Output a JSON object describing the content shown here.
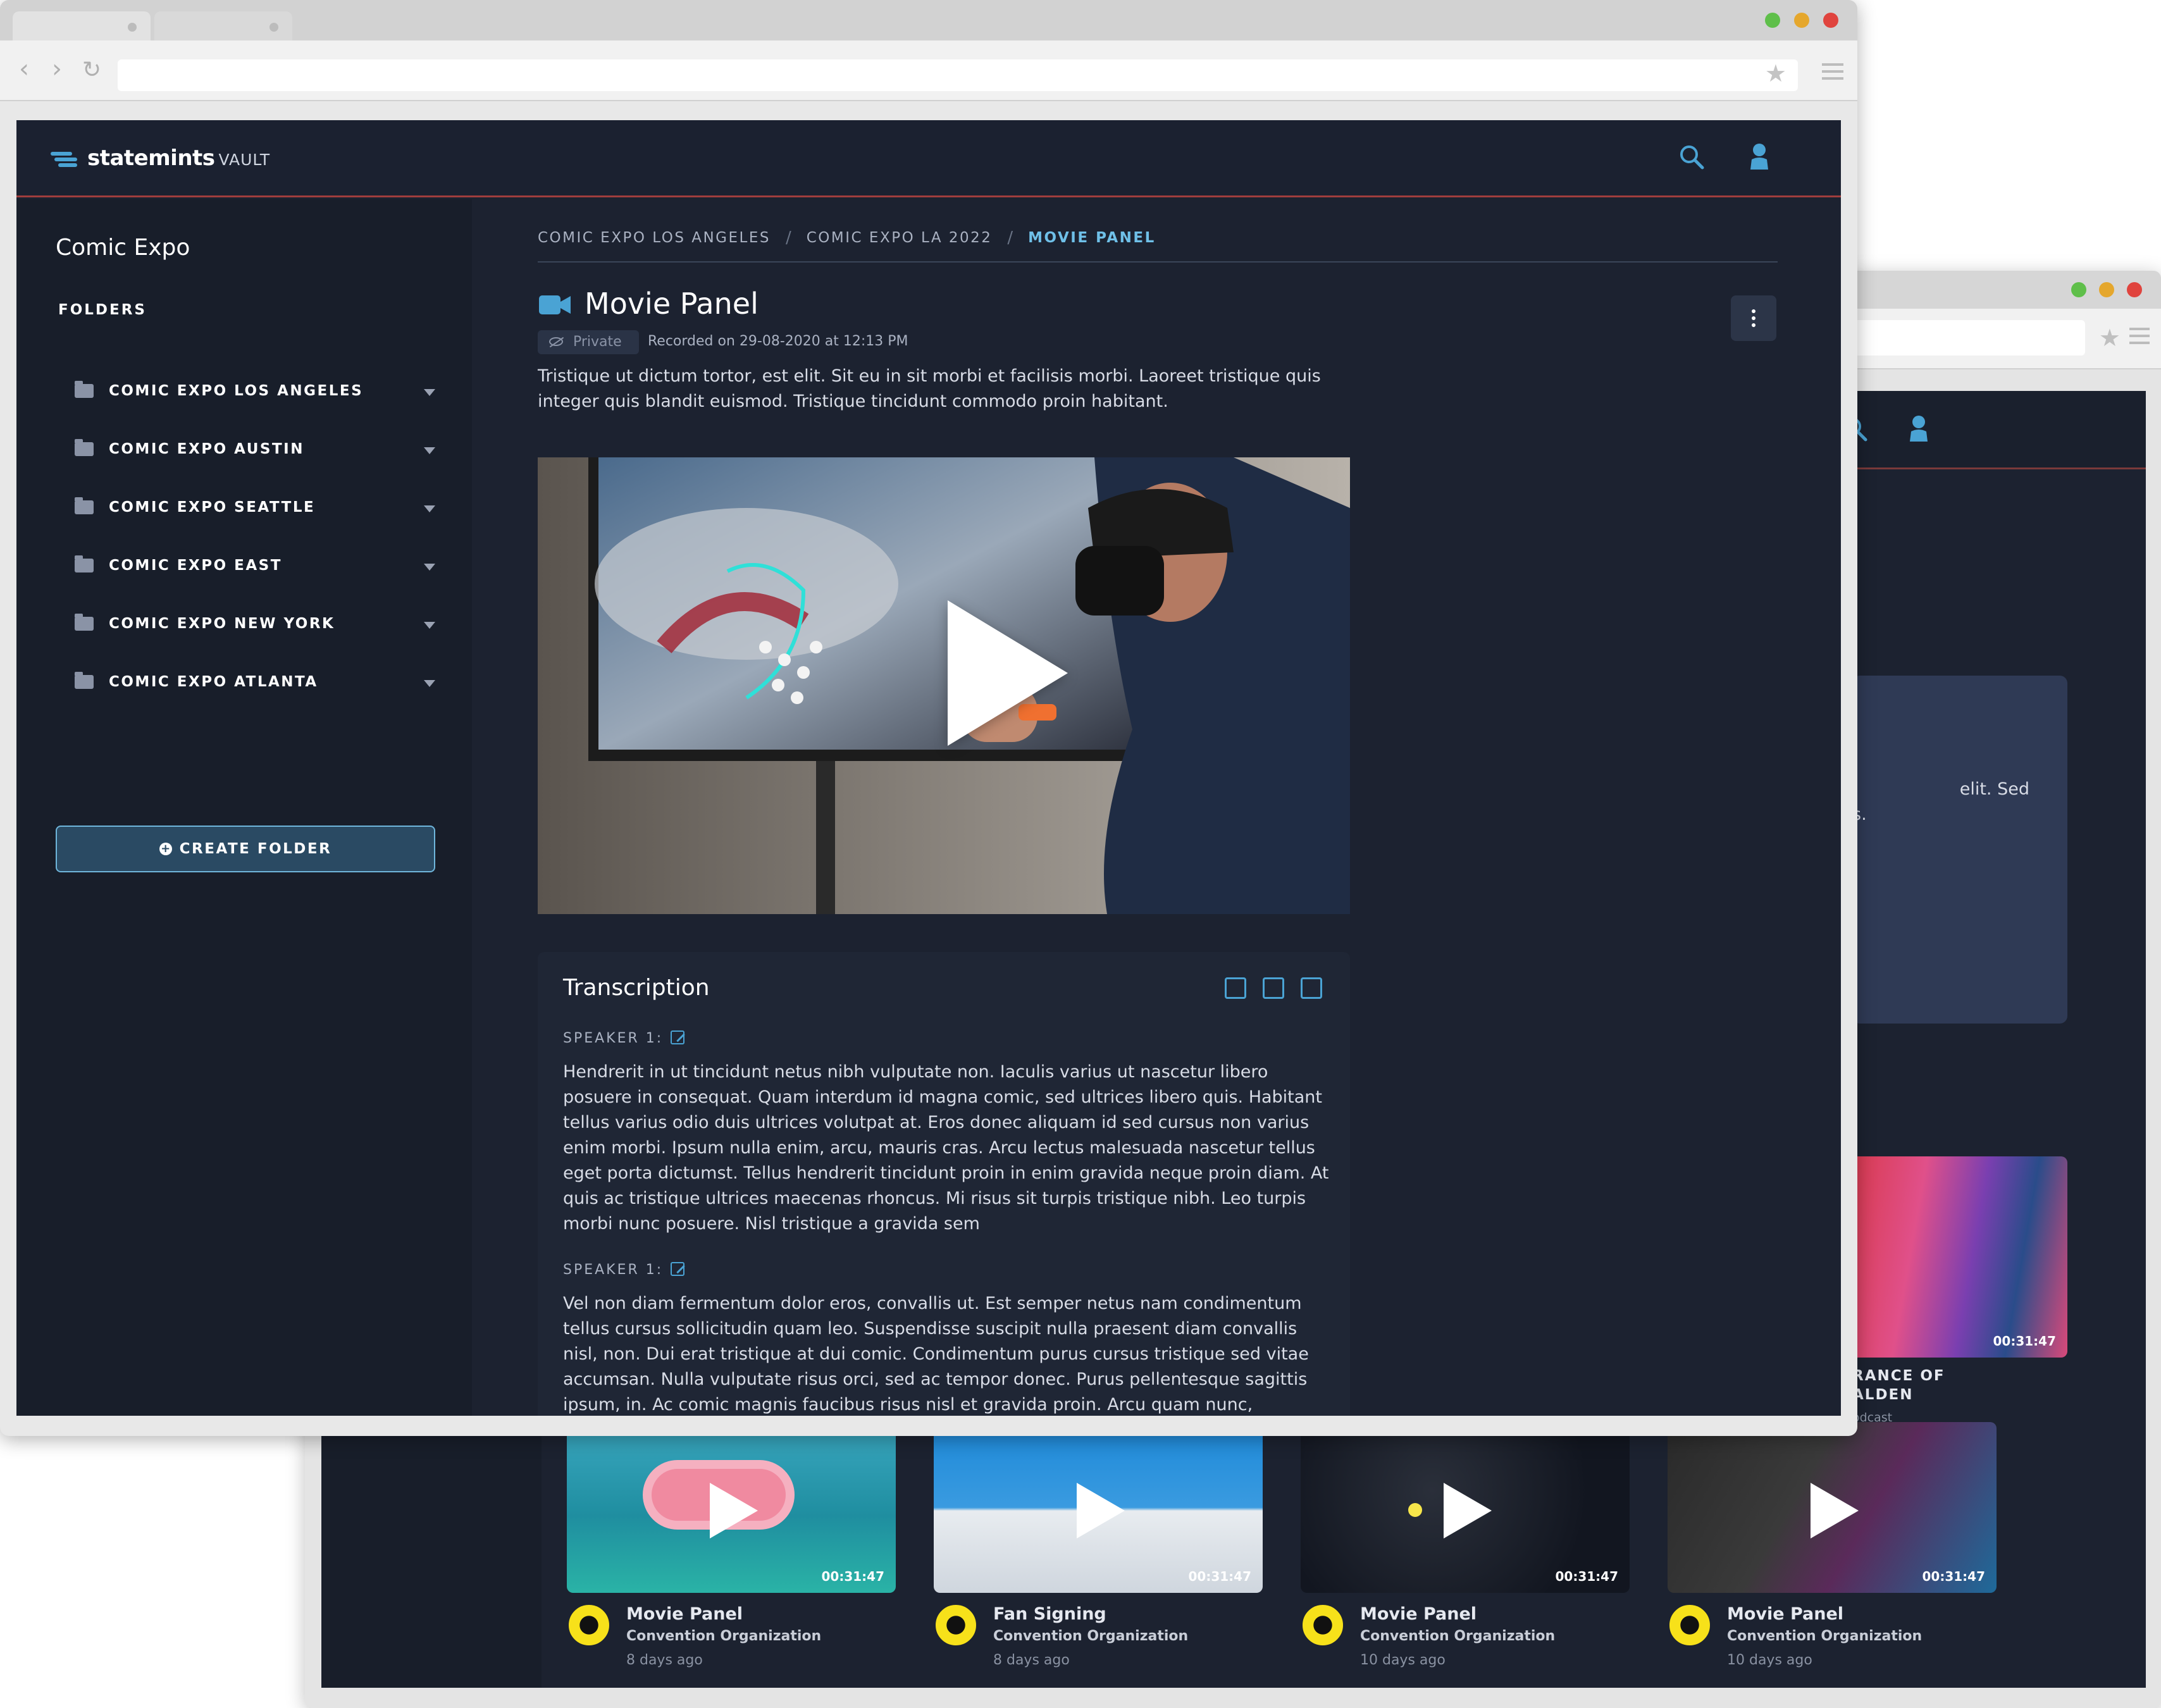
{
  "brand": {
    "name": "statemints",
    "sub": "VAULT"
  },
  "sidebar": {
    "title": "Comic Expo",
    "folders_label": "FOLDERS",
    "folders": [
      {
        "label": "COMIC EXPO LOS ANGELES"
      },
      {
        "label": "COMIC EXPO AUSTIN"
      },
      {
        "label": "COMIC EXPO SEATTLE"
      },
      {
        "label": "COMIC EXPO EAST"
      },
      {
        "label": "COMIC EXPO NEW YORK"
      },
      {
        "label": "COMIC EXPO ATLANTA"
      }
    ],
    "create_button": "CREATE FOLDER"
  },
  "breadcrumb": [
    {
      "label": "COMIC EXPO LOS ANGELES"
    },
    {
      "label": "COMIC EXPO LA 2022"
    },
    {
      "label": "MOVIE PANEL"
    }
  ],
  "page": {
    "title": "Movie Panel",
    "privacy": "Private",
    "recorded": "Recorded on 29-08-2020 at 12:13 PM",
    "description": "Tristique ut dictum tortor, est elit. Sit eu in sit morbi et facilisis morbi. Laoreet tristique quis integer quis blandit euismod. Tristique tincidunt commodo proin habitant."
  },
  "transcription": {
    "title": "Transcription",
    "blocks": [
      {
        "speaker": "SPEAKER 1:",
        "text": "Hendrerit in ut tincidunt netus nibh vulputate non. Iaculis varius ut nascetur libero posuere in consequat. Quam interdum id magna comic, sed ultrices libero quis. Habitant tellus varius odio duis ultrices volutpat at. Eros donec aliquam id sed cursus non varius enim morbi. Ipsum nulla enim, arcu, mauris cras. Arcu lectus malesuada nascetur tellus eget porta dictumst. Tellus hendrerit tincidunt proin in enim gravida neque proin diam. At quis ac tristique ultrices maecenas rhoncus. Mi risus sit turpis tristique nibh. Leo turpis morbi nunc posuere. Nisl tristique a gravida sem"
      },
      {
        "speaker": "SPEAKER 1:",
        "text": "Vel non diam fermentum dolor eros, convallis ut. Est semper netus nam condimentum tellus cursus sollicitudin quam leo. Suspendisse suscipit nulla praesent diam convallis nisl, non. Dui erat tristique at dui comic. Condimentum purus cursus tristique sed vitae accumsan. Nulla vulputate risus orci, sed ac tempor donec. Purus pellentesque sagittis ipsum, in. Ac comic magnis faucibus risus nisl et gravida proin. Arcu quam nunc,"
      }
    ]
  },
  "back_window": {
    "panel_text_1": "elit. Sed",
    "panel_text_2": "s.",
    "featured": {
      "duration": "00:31:47",
      "title_line1": "RANCE OF",
      "title_line2": "ALDEN",
      "sub": "odcast"
    },
    "cards": [
      {
        "title": "Movie Panel",
        "org": "Convention Organization",
        "age": "8 days ago",
        "duration": "00:31:47"
      },
      {
        "title": "Fan Signing",
        "org": "Convention Organization",
        "age": "8 days ago",
        "duration": "00:31:47"
      },
      {
        "title": "Movie Panel",
        "org": "Convention Organization",
        "age": "10 days ago",
        "duration": "00:31:47"
      },
      {
        "title": "Movie Panel",
        "org": "Convention Organization",
        "age": "10 days ago",
        "duration": "00:31:47"
      }
    ]
  },
  "icons": {
    "search": "search-icon",
    "user": "user-icon",
    "camera": "video-camera-icon",
    "kebab": "kebab-menu-icon",
    "folder": "folder-icon"
  },
  "colors": {
    "accent": "#4aa3d4",
    "background": "#1c2230",
    "sidebar": "#181e2a",
    "topbar_border": "#a03d3d"
  }
}
